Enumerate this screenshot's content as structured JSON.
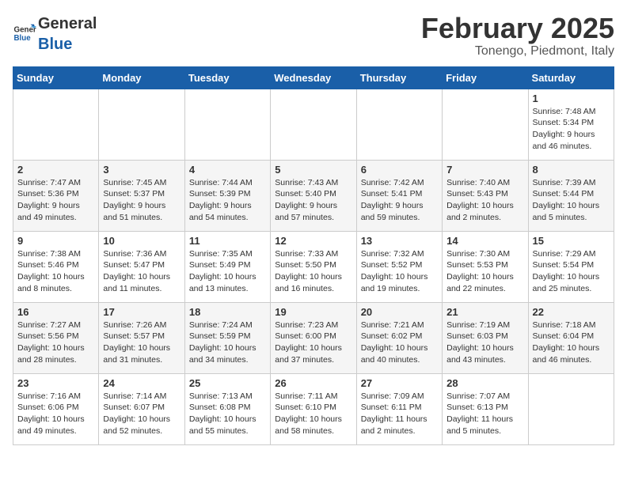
{
  "header": {
    "logo_general": "General",
    "logo_blue": "Blue",
    "month_title": "February 2025",
    "location": "Tonengo, Piedmont, Italy"
  },
  "days_of_week": [
    "Sunday",
    "Monday",
    "Tuesday",
    "Wednesday",
    "Thursday",
    "Friday",
    "Saturday"
  ],
  "weeks": [
    [
      {
        "day": "",
        "info": ""
      },
      {
        "day": "",
        "info": ""
      },
      {
        "day": "",
        "info": ""
      },
      {
        "day": "",
        "info": ""
      },
      {
        "day": "",
        "info": ""
      },
      {
        "day": "",
        "info": ""
      },
      {
        "day": "1",
        "info": "Sunrise: 7:48 AM\nSunset: 5:34 PM\nDaylight: 9 hours and 46 minutes."
      }
    ],
    [
      {
        "day": "2",
        "info": "Sunrise: 7:47 AM\nSunset: 5:36 PM\nDaylight: 9 hours and 49 minutes."
      },
      {
        "day": "3",
        "info": "Sunrise: 7:45 AM\nSunset: 5:37 PM\nDaylight: 9 hours and 51 minutes."
      },
      {
        "day": "4",
        "info": "Sunrise: 7:44 AM\nSunset: 5:39 PM\nDaylight: 9 hours and 54 minutes."
      },
      {
        "day": "5",
        "info": "Sunrise: 7:43 AM\nSunset: 5:40 PM\nDaylight: 9 hours and 57 minutes."
      },
      {
        "day": "6",
        "info": "Sunrise: 7:42 AM\nSunset: 5:41 PM\nDaylight: 9 hours and 59 minutes."
      },
      {
        "day": "7",
        "info": "Sunrise: 7:40 AM\nSunset: 5:43 PM\nDaylight: 10 hours and 2 minutes."
      },
      {
        "day": "8",
        "info": "Sunrise: 7:39 AM\nSunset: 5:44 PM\nDaylight: 10 hours and 5 minutes."
      }
    ],
    [
      {
        "day": "9",
        "info": "Sunrise: 7:38 AM\nSunset: 5:46 PM\nDaylight: 10 hours and 8 minutes."
      },
      {
        "day": "10",
        "info": "Sunrise: 7:36 AM\nSunset: 5:47 PM\nDaylight: 10 hours and 11 minutes."
      },
      {
        "day": "11",
        "info": "Sunrise: 7:35 AM\nSunset: 5:49 PM\nDaylight: 10 hours and 13 minutes."
      },
      {
        "day": "12",
        "info": "Sunrise: 7:33 AM\nSunset: 5:50 PM\nDaylight: 10 hours and 16 minutes."
      },
      {
        "day": "13",
        "info": "Sunrise: 7:32 AM\nSunset: 5:52 PM\nDaylight: 10 hours and 19 minutes."
      },
      {
        "day": "14",
        "info": "Sunrise: 7:30 AM\nSunset: 5:53 PM\nDaylight: 10 hours and 22 minutes."
      },
      {
        "day": "15",
        "info": "Sunrise: 7:29 AM\nSunset: 5:54 PM\nDaylight: 10 hours and 25 minutes."
      }
    ],
    [
      {
        "day": "16",
        "info": "Sunrise: 7:27 AM\nSunset: 5:56 PM\nDaylight: 10 hours and 28 minutes."
      },
      {
        "day": "17",
        "info": "Sunrise: 7:26 AM\nSunset: 5:57 PM\nDaylight: 10 hours and 31 minutes."
      },
      {
        "day": "18",
        "info": "Sunrise: 7:24 AM\nSunset: 5:59 PM\nDaylight: 10 hours and 34 minutes."
      },
      {
        "day": "19",
        "info": "Sunrise: 7:23 AM\nSunset: 6:00 PM\nDaylight: 10 hours and 37 minutes."
      },
      {
        "day": "20",
        "info": "Sunrise: 7:21 AM\nSunset: 6:02 PM\nDaylight: 10 hours and 40 minutes."
      },
      {
        "day": "21",
        "info": "Sunrise: 7:19 AM\nSunset: 6:03 PM\nDaylight: 10 hours and 43 minutes."
      },
      {
        "day": "22",
        "info": "Sunrise: 7:18 AM\nSunset: 6:04 PM\nDaylight: 10 hours and 46 minutes."
      }
    ],
    [
      {
        "day": "23",
        "info": "Sunrise: 7:16 AM\nSunset: 6:06 PM\nDaylight: 10 hours and 49 minutes."
      },
      {
        "day": "24",
        "info": "Sunrise: 7:14 AM\nSunset: 6:07 PM\nDaylight: 10 hours and 52 minutes."
      },
      {
        "day": "25",
        "info": "Sunrise: 7:13 AM\nSunset: 6:08 PM\nDaylight: 10 hours and 55 minutes."
      },
      {
        "day": "26",
        "info": "Sunrise: 7:11 AM\nSunset: 6:10 PM\nDaylight: 10 hours and 58 minutes."
      },
      {
        "day": "27",
        "info": "Sunrise: 7:09 AM\nSunset: 6:11 PM\nDaylight: 11 hours and 2 minutes."
      },
      {
        "day": "28",
        "info": "Sunrise: 7:07 AM\nSunset: 6:13 PM\nDaylight: 11 hours and 5 minutes."
      },
      {
        "day": "",
        "info": ""
      }
    ]
  ]
}
